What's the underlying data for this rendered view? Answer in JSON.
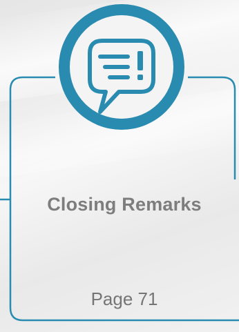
{
  "card": {
    "title": "Closing Remarks",
    "page_label": "Page 71",
    "icon": "speech-bubble-exclamation-icon",
    "accent_color": "#2a8bb0"
  }
}
